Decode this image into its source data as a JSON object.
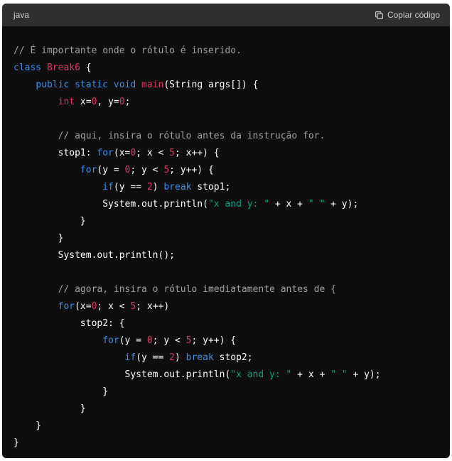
{
  "header": {
    "language": "java",
    "copy_label": "Copiar código"
  },
  "code": {
    "lines": [
      [
        {
          "t": "// É importante onde o rótulo é inserido.",
          "c": "c"
        }
      ],
      [
        {
          "t": "class ",
          "c": "k"
        },
        {
          "t": "Break6",
          "c": "t"
        },
        {
          "t": " {",
          "c": ""
        }
      ],
      [
        {
          "t": "    ",
          "c": ""
        },
        {
          "t": "public",
          "c": "k"
        },
        {
          "t": " ",
          "c": ""
        },
        {
          "t": "static",
          "c": "k"
        },
        {
          "t": " ",
          "c": ""
        },
        {
          "t": "void",
          "c": "k"
        },
        {
          "t": " ",
          "c": ""
        },
        {
          "t": "main",
          "c": "t"
        },
        {
          "t": "(String args[]) {",
          "c": ""
        }
      ],
      [
        {
          "t": "        ",
          "c": ""
        },
        {
          "t": "int",
          "c": "t"
        },
        {
          "t": " x=",
          "c": ""
        },
        {
          "t": "0",
          "c": "n"
        },
        {
          "t": ", y=",
          "c": ""
        },
        {
          "t": "0",
          "c": "n"
        },
        {
          "t": ";",
          "c": ""
        }
      ],
      [
        {
          "t": "",
          "c": ""
        }
      ],
      [
        {
          "t": "        ",
          "c": ""
        },
        {
          "t": "// aqui, insira o rótulo antes da instrução for.",
          "c": "c"
        }
      ],
      [
        {
          "t": "        stop1: ",
          "c": ""
        },
        {
          "t": "for",
          "c": "k"
        },
        {
          "t": "(x=",
          "c": ""
        },
        {
          "t": "0",
          "c": "n"
        },
        {
          "t": "; x < ",
          "c": ""
        },
        {
          "t": "5",
          "c": "n"
        },
        {
          "t": "; x++) {",
          "c": ""
        }
      ],
      [
        {
          "t": "            ",
          "c": ""
        },
        {
          "t": "for",
          "c": "k"
        },
        {
          "t": "(y = ",
          "c": ""
        },
        {
          "t": "0",
          "c": "n"
        },
        {
          "t": "; y < ",
          "c": ""
        },
        {
          "t": "5",
          "c": "n"
        },
        {
          "t": "; y++) {",
          "c": ""
        }
      ],
      [
        {
          "t": "                ",
          "c": ""
        },
        {
          "t": "if",
          "c": "k"
        },
        {
          "t": "(y == ",
          "c": ""
        },
        {
          "t": "2",
          "c": "n"
        },
        {
          "t": ") ",
          "c": ""
        },
        {
          "t": "break",
          "c": "k"
        },
        {
          "t": " stop1;",
          "c": ""
        }
      ],
      [
        {
          "t": "                System.out.println(",
          "c": ""
        },
        {
          "t": "\"x and y: \"",
          "c": "s"
        },
        {
          "t": " + x + ",
          "c": ""
        },
        {
          "t": "\" \"",
          "c": "s"
        },
        {
          "t": " + y);",
          "c": ""
        }
      ],
      [
        {
          "t": "            }",
          "c": ""
        }
      ],
      [
        {
          "t": "        }",
          "c": ""
        }
      ],
      [
        {
          "t": "        System.out.println();",
          "c": ""
        }
      ],
      [
        {
          "t": "",
          "c": ""
        }
      ],
      [
        {
          "t": "        ",
          "c": ""
        },
        {
          "t": "// agora, insira o rótulo imediatamente antes de {",
          "c": "c"
        }
      ],
      [
        {
          "t": "        ",
          "c": ""
        },
        {
          "t": "for",
          "c": "k"
        },
        {
          "t": "(x=",
          "c": ""
        },
        {
          "t": "0",
          "c": "n"
        },
        {
          "t": "; x < ",
          "c": ""
        },
        {
          "t": "5",
          "c": "n"
        },
        {
          "t": "; x++)",
          "c": ""
        }
      ],
      [
        {
          "t": "            stop2: {",
          "c": ""
        }
      ],
      [
        {
          "t": "                ",
          "c": ""
        },
        {
          "t": "for",
          "c": "k"
        },
        {
          "t": "(y = ",
          "c": ""
        },
        {
          "t": "0",
          "c": "n"
        },
        {
          "t": "; y < ",
          "c": ""
        },
        {
          "t": "5",
          "c": "n"
        },
        {
          "t": "; y++) {",
          "c": ""
        }
      ],
      [
        {
          "t": "                    ",
          "c": ""
        },
        {
          "t": "if",
          "c": "k"
        },
        {
          "t": "(y == ",
          "c": ""
        },
        {
          "t": "2",
          "c": "n"
        },
        {
          "t": ") ",
          "c": ""
        },
        {
          "t": "break",
          "c": "k"
        },
        {
          "t": " stop2;",
          "c": ""
        }
      ],
      [
        {
          "t": "                    System.out.println(",
          "c": ""
        },
        {
          "t": "\"x and y: \"",
          "c": "s"
        },
        {
          "t": " + x + ",
          "c": ""
        },
        {
          "t": "\" \"",
          "c": "s"
        },
        {
          "t": " + y);",
          "c": ""
        }
      ],
      [
        {
          "t": "                }",
          "c": ""
        }
      ],
      [
        {
          "t": "            }",
          "c": ""
        }
      ],
      [
        {
          "t": "    }",
          "c": ""
        }
      ],
      [
        {
          "t": "}",
          "c": ""
        }
      ]
    ]
  },
  "colors": {
    "background": "#0d0d0d",
    "header": "#2f2f2f",
    "comment": "#a0a0a0",
    "keyword": "#3b8eea",
    "type": "#e4325f",
    "string": "#00a67d"
  }
}
